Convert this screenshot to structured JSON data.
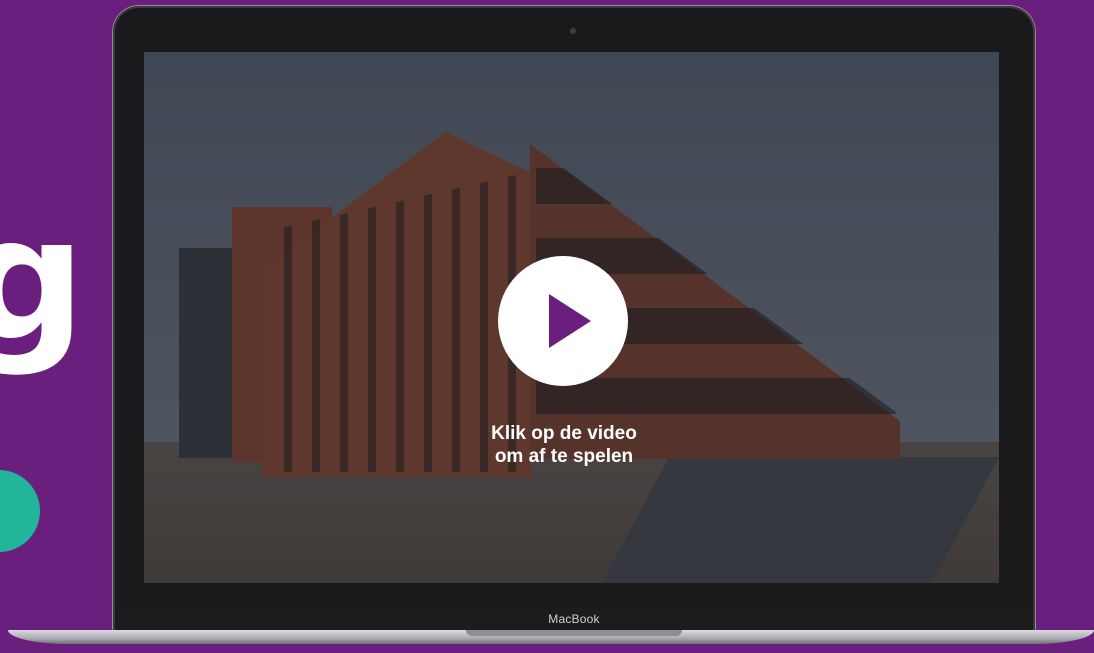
{
  "page": {
    "background_color": "#6a1f7f",
    "left_letter": "g",
    "left_dot_color": "#21b59b"
  },
  "device": {
    "brand_label": "MacBook"
  },
  "video": {
    "play_icon_color": "#6a1f7f",
    "caption_line1": "Klik op de video",
    "caption_line2": "om af te spelen"
  }
}
